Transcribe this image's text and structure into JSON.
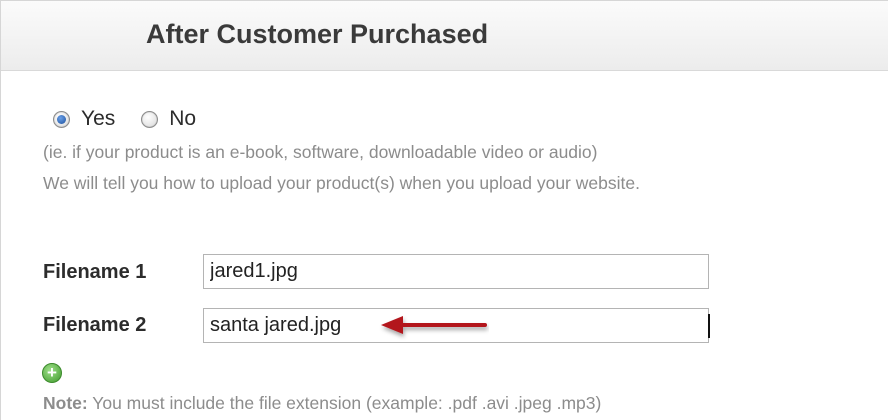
{
  "header": {
    "title": "After Customer Purchased"
  },
  "radio": {
    "yes_label": "Yes",
    "no_label": "No",
    "selected": "Yes"
  },
  "help": {
    "line1": "(ie. if your product is an e-book, software, downloadable video or audio)",
    "line2": "We will tell you how to upload your product(s) when you upload your website."
  },
  "fields": [
    {
      "label": "Filename 1",
      "value": "jared1.jpg"
    },
    {
      "label": "Filename 2",
      "value": "santa jared.jpg"
    }
  ],
  "add_icon": "plus-circle-icon",
  "note": {
    "prefix": "Note:",
    "text": " You must include the file extension (example: .pdf .avi .jpeg .mp3)"
  },
  "colors": {
    "arrow": "#b3151b",
    "radio_selected": "#1c4f9c",
    "add_button": "#3f9a2c"
  }
}
